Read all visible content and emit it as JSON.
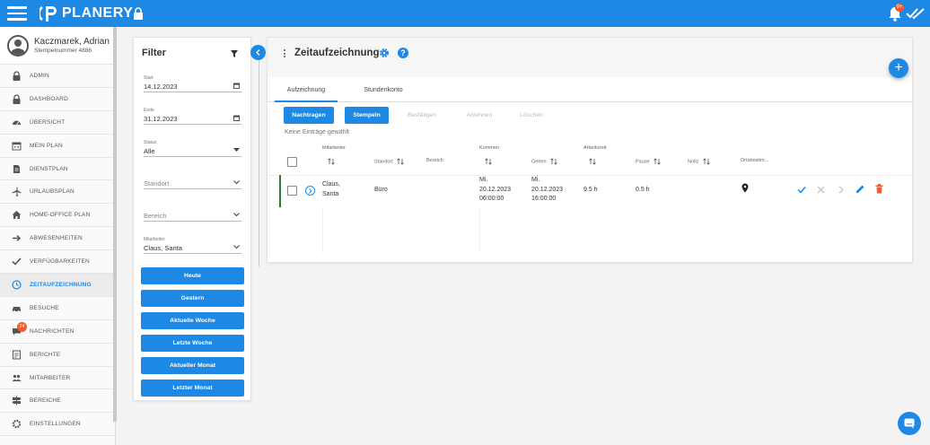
{
  "app": {
    "name": "PLANERY"
  },
  "colors": {
    "primary": "#1e88e5",
    "badge": "#ff5722",
    "row_indicator": "#2e7d32",
    "delete": "#ff5722"
  },
  "notifications": {
    "badge": "9+"
  },
  "user": {
    "name": "Kaczmarek, Adrian",
    "sub": "Stempelnummer 4886"
  },
  "nav": [
    {
      "label": "ADMIN",
      "icon": "lock-icon"
    },
    {
      "label": "DASHBOARD",
      "icon": "lock-icon"
    },
    {
      "label": "ÜBERSICHT",
      "icon": "speedometer-icon"
    },
    {
      "label": "MEIN PLAN",
      "icon": "calendar-icon"
    },
    {
      "label": "DIENSTPLAN",
      "icon": "document-icon"
    },
    {
      "label": "URLAUBSPLAN",
      "icon": "plane-icon"
    },
    {
      "label": "HOME-OFFICE PLAN",
      "icon": "home-icon"
    },
    {
      "label": "ABWESENHEITEN",
      "icon": "arrow-right-icon"
    },
    {
      "label": "VERFÜGBARKEITEN",
      "icon": "check-icon"
    },
    {
      "label": "ZEITAUFZEICHNUNG",
      "icon": "clock-icon",
      "active": true
    },
    {
      "label": "BESUCHE",
      "icon": "car-icon"
    },
    {
      "label": "NACHRICHTEN",
      "icon": "chat-icon",
      "badge": "24"
    },
    {
      "label": "BERICHTE",
      "icon": "report-icon"
    },
    {
      "label": "MITARBEITER",
      "icon": "people-icon"
    },
    {
      "label": "BEREICHE",
      "icon": "signpost-icon"
    },
    {
      "label": "EINSTELLUNGEN",
      "icon": "gear-icon"
    }
  ],
  "filter": {
    "title": "Filter",
    "start_label": "Start",
    "start_value": "14.12.2023",
    "end_label": "Ende",
    "end_value": "31.12.2023",
    "status_label": "Status",
    "status_value": "Alle",
    "standort_placeholder": "Standort",
    "bereich_placeholder": "Bereich",
    "mitarbeiter_label": "Mitarbeiter",
    "mitarbeiter_value": "Claus, Santa",
    "quick_buttons": [
      "Heute",
      "Gestern",
      "Aktuelle Woche",
      "Letzte Woche",
      "Aktueller Monat",
      "Letzter Monat"
    ]
  },
  "main": {
    "title": "Zeitaufzeichnung",
    "tabs": [
      "Aufzeichnung",
      "Stundenkonto"
    ],
    "actions": [
      "Nachtragen",
      "Stempeln",
      "Bestätigen",
      "Ablehnen",
      "Löschen"
    ],
    "empty_note": "Keine Einträge gewählt",
    "columns": {
      "mitarbeiter": "Mitarbeiter",
      "standort": "Standort",
      "bereich": "Bereich",
      "kommen": "Kommen",
      "gehen": "Gehen",
      "arbeitszeit": "Arbeitszeit",
      "pause": "Pause",
      "notiz": "Notiz",
      "ortsbestimmung": "Ortsbestim..."
    },
    "rows": [
      {
        "mitarbeiter_line1": "Claus,",
        "mitarbeiter_line2": "Santa",
        "standort": "Büro",
        "kommen_day": "Mi.",
        "kommen_date": "20.12.2023",
        "kommen_time": "06:00:00",
        "gehen_day": "Mi.",
        "gehen_date": "20.12.2023",
        "gehen_time": "16:00:00",
        "arbeitszeit": "9.5 h",
        "pause": "0.5 h"
      }
    ]
  }
}
